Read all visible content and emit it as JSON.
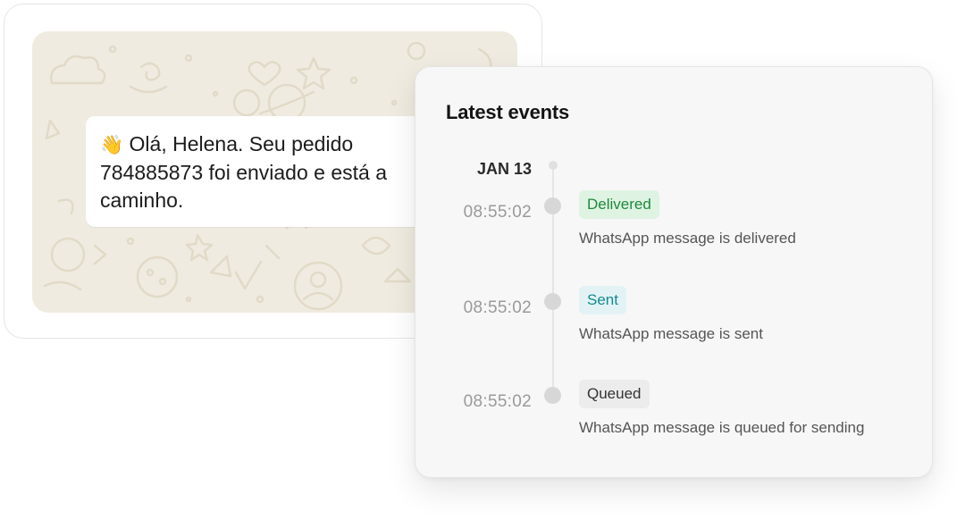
{
  "chat": {
    "emoji": "👋",
    "message_line1": "Olá, Helena. Seu pedido",
    "message_line2": "784885873 foi enviado e está a",
    "message_line3": "caminho."
  },
  "events": {
    "title": "Latest events",
    "date": "JAN 13",
    "items": [
      {
        "time": "08:55:02",
        "status": "Delivered",
        "description": "WhatsApp message is delivered"
      },
      {
        "time": "08:55:02",
        "status": "Sent",
        "description": "WhatsApp message is sent"
      },
      {
        "time": "08:55:02",
        "status": "Queued",
        "description": "WhatsApp message is queued for sending"
      }
    ]
  },
  "colors": {
    "delivered_badge": "#dff3e3",
    "delivered_text": "#1f8a3a",
    "sent_badge": "#e3f3f5",
    "sent_text": "#148a8f",
    "queued_badge": "#ececec",
    "wallpaper": "#f0ebe0"
  }
}
